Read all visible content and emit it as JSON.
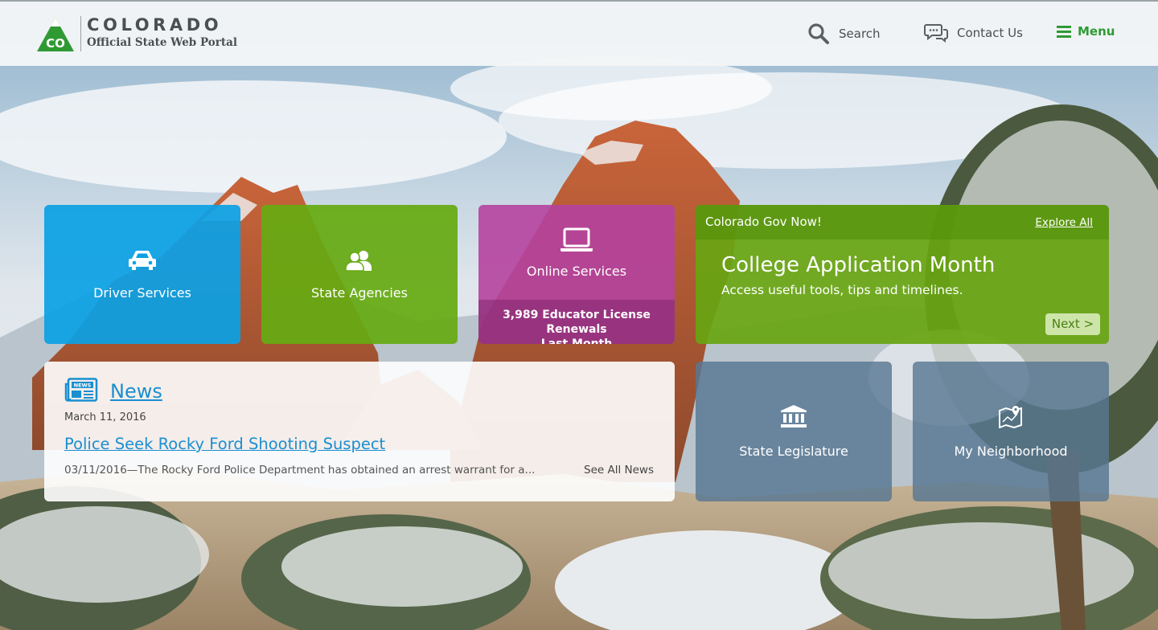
{
  "header": {
    "logo_abbrev": "CO",
    "logo_title": "COLORADO",
    "logo_subtitle": "Official State Web Portal",
    "nav": {
      "search": "Search",
      "contact": "Contact Us",
      "menu": "Menu"
    }
  },
  "tiles": {
    "driver": {
      "label": "Driver Services",
      "icon": "car-icon"
    },
    "agencies": {
      "label": "State Agencies",
      "icon": "people-icon"
    },
    "online": {
      "label": "Online Services",
      "icon": "laptop-icon",
      "stat_line1": "3,989 Educator License Renewals",
      "stat_line2": "Last Month"
    },
    "legislature": {
      "label": "State Legislature",
      "icon": "capitol-icon"
    },
    "neighborhood": {
      "label": "My Neighborhood",
      "icon": "map-icon"
    }
  },
  "gov_now": {
    "title": "Colorado Gov Now!",
    "explore": "Explore All",
    "headline": "College Application Month",
    "subtitle": "Access useful tools, tips and timelines.",
    "next": "Next >"
  },
  "news": {
    "heading": "News",
    "date": "March 11, 2016",
    "story_title": "Police Seek Rocky Ford Shooting Suspect",
    "snippet": "03/11/2016—The Rocky Ford Police Department has obtained an arrest warrant for a...",
    "see_all": "See All News",
    "icon_text": "NEWS"
  },
  "colors": {
    "brand_green": "#2f9a34",
    "driver_blue": "#0ca0e4",
    "agency_green": "#66aa12",
    "online_magenta": "#b5439e",
    "slate_tile": "#587892",
    "link_blue": "#1a8fd1"
  }
}
